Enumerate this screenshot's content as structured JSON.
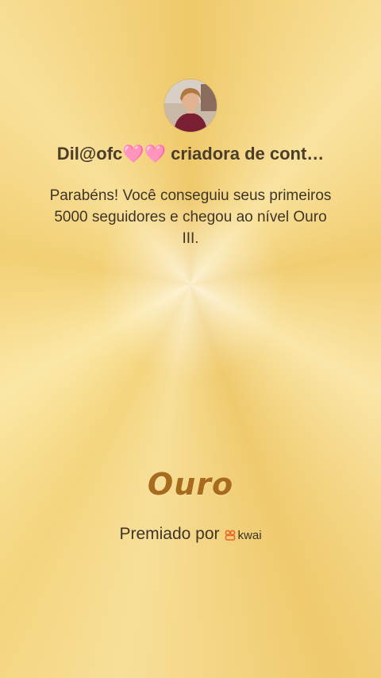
{
  "profile": {
    "name": "Dil@ofc🩷🩷 criadora de cont…",
    "avatar_icon": "profile-photo"
  },
  "message": "Parabéns! Você conseguiu seus primeiros 5000 seguidores e chegou ao nível Ouro III.",
  "level": "Ouro",
  "awarded": {
    "label": "Premiado por",
    "brand": "kwai"
  },
  "colors": {
    "gold_text": "#a86a1c",
    "body_text": "#3f3526",
    "accent_logo": "#e8672a"
  }
}
